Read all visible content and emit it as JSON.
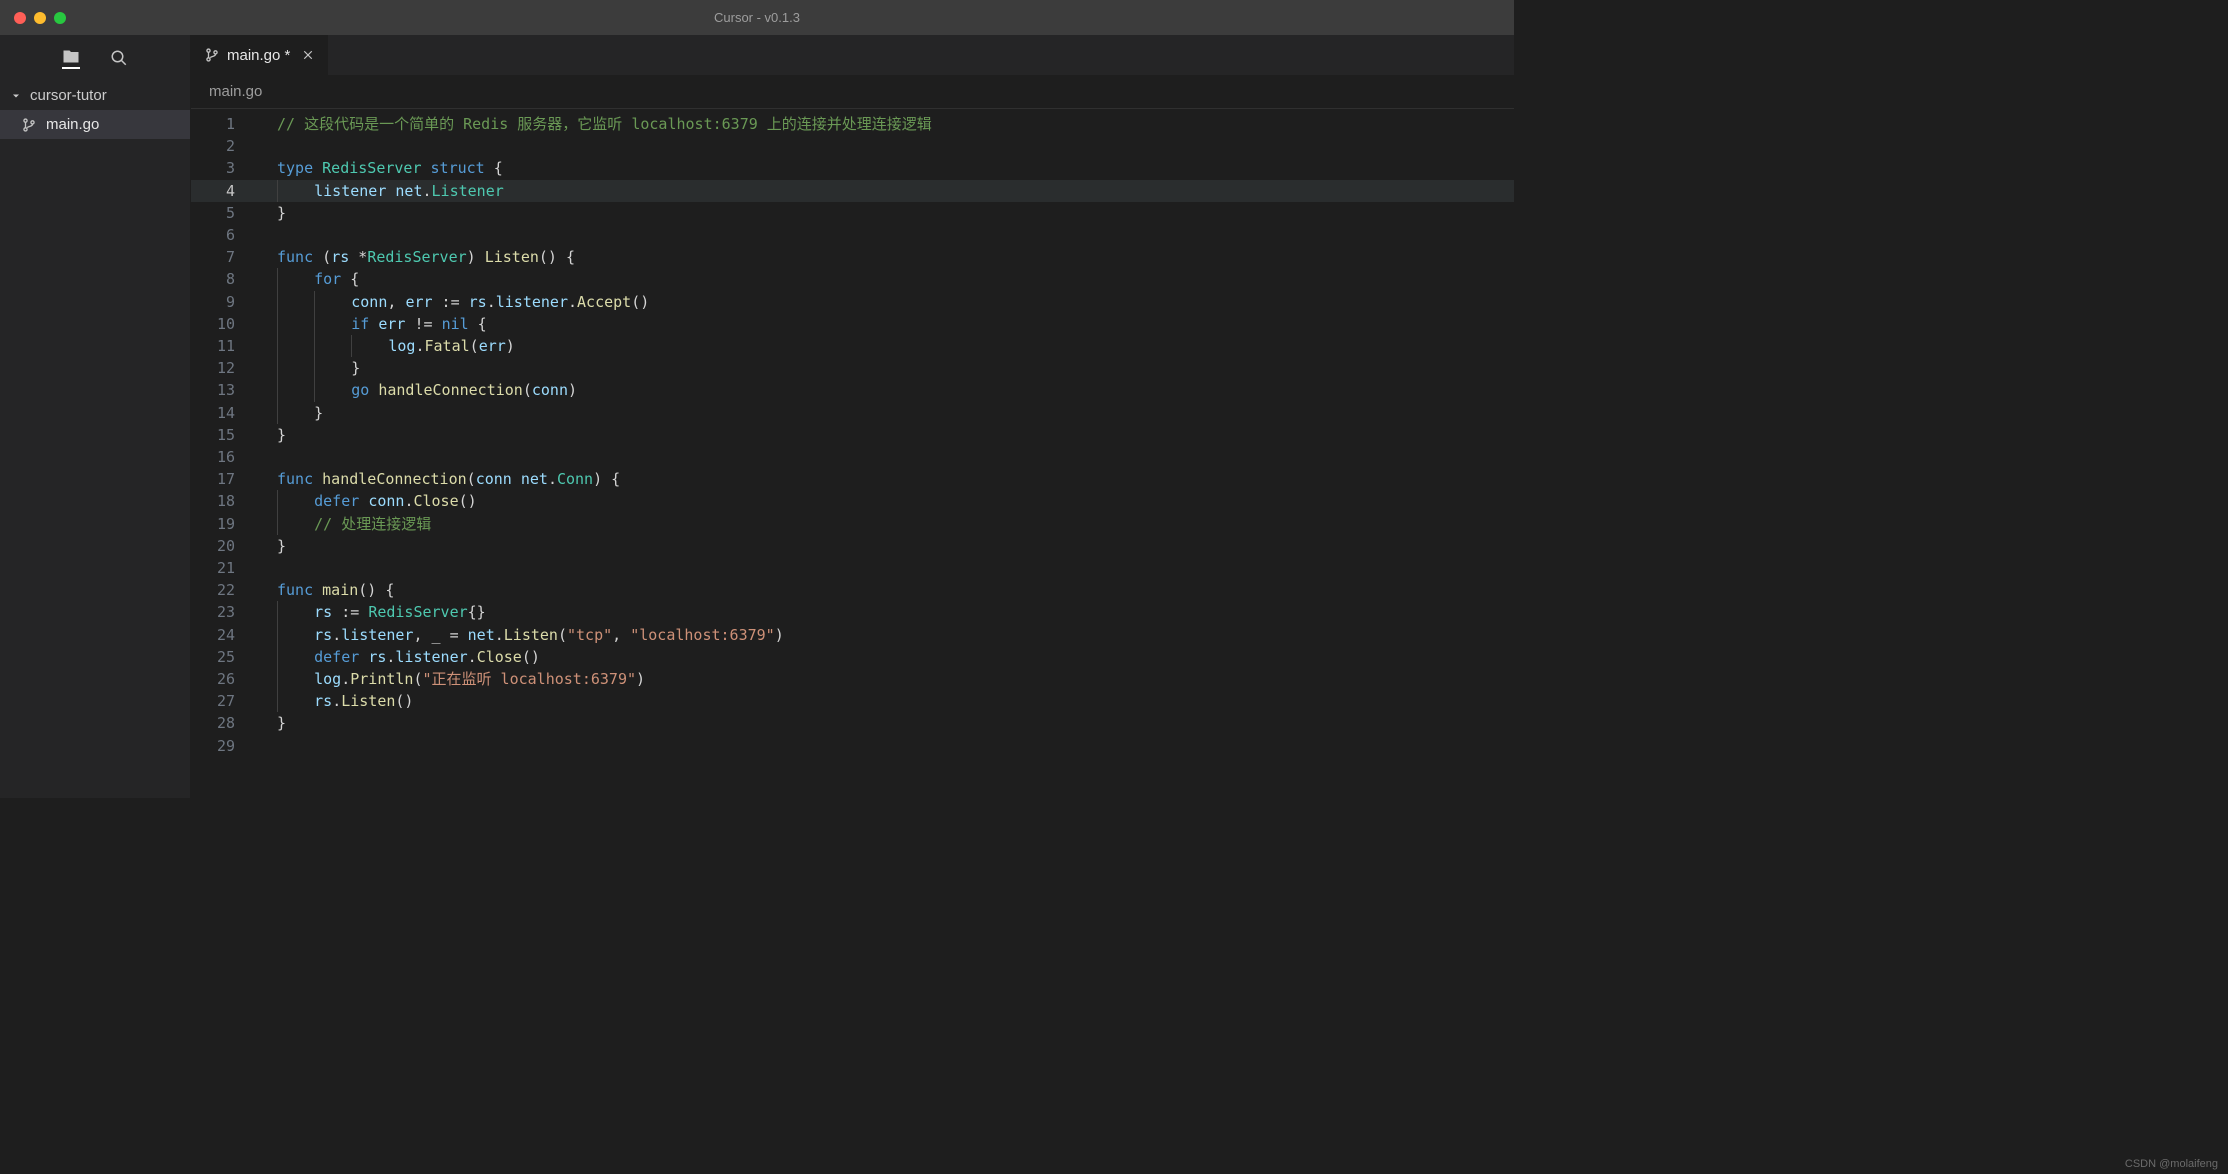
{
  "titlebar": {
    "title": "Cursor - v0.1.3"
  },
  "sidebar": {
    "project": "cursor-tutor",
    "files": [
      "main.go"
    ]
  },
  "tabs": [
    {
      "label": "main.go *"
    }
  ],
  "breadcrumb": "main.go",
  "active_line": 4,
  "code": {
    "lines": [
      {
        "n": 1,
        "seg": [
          {
            "t": "// 这段代码是一个简单的 Redis 服务器，它监听 localhost:6379 上的连接并处理连接逻辑",
            "c": "cmt"
          }
        ],
        "indent": 0
      },
      {
        "n": 2,
        "seg": [],
        "indent": 0
      },
      {
        "n": 3,
        "seg": [
          {
            "t": "type",
            "c": "kw"
          },
          {
            "t": " ",
            "c": "pl"
          },
          {
            "t": "RedisServer",
            "c": "type"
          },
          {
            "t": " ",
            "c": "pl"
          },
          {
            "t": "struct",
            "c": "kw"
          },
          {
            "t": " {",
            "c": "pl"
          }
        ],
        "indent": 0
      },
      {
        "n": 4,
        "seg": [
          {
            "t": "listener",
            "c": "id"
          },
          {
            "t": " ",
            "c": "pl"
          },
          {
            "t": "net",
            "c": "id"
          },
          {
            "t": ".",
            "c": "pl"
          },
          {
            "t": "Listener",
            "c": "type"
          }
        ],
        "indent": 1
      },
      {
        "n": 5,
        "seg": [
          {
            "t": "}",
            "c": "pl"
          }
        ],
        "indent": 0
      },
      {
        "n": 6,
        "seg": [],
        "indent": 0
      },
      {
        "n": 7,
        "seg": [
          {
            "t": "func",
            "c": "kw"
          },
          {
            "t": " (",
            "c": "pl"
          },
          {
            "t": "rs",
            "c": "id"
          },
          {
            "t": " *",
            "c": "pl"
          },
          {
            "t": "RedisServer",
            "c": "type"
          },
          {
            "t": ") ",
            "c": "pl"
          },
          {
            "t": "Listen",
            "c": "fn"
          },
          {
            "t": "() {",
            "c": "pl"
          }
        ],
        "indent": 0
      },
      {
        "n": 8,
        "seg": [
          {
            "t": "for",
            "c": "kw"
          },
          {
            "t": " {",
            "c": "pl"
          }
        ],
        "indent": 1
      },
      {
        "n": 9,
        "seg": [
          {
            "t": "conn",
            "c": "id"
          },
          {
            "t": ", ",
            "c": "pl"
          },
          {
            "t": "err",
            "c": "id"
          },
          {
            "t": " := ",
            "c": "pl"
          },
          {
            "t": "rs",
            "c": "id"
          },
          {
            "t": ".",
            "c": "pl"
          },
          {
            "t": "listener",
            "c": "id"
          },
          {
            "t": ".",
            "c": "pl"
          },
          {
            "t": "Accept",
            "c": "fn"
          },
          {
            "t": "()",
            "c": "pl"
          }
        ],
        "indent": 2
      },
      {
        "n": 10,
        "seg": [
          {
            "t": "if",
            "c": "kw"
          },
          {
            "t": " ",
            "c": "pl"
          },
          {
            "t": "err",
            "c": "id"
          },
          {
            "t": " != ",
            "c": "pl"
          },
          {
            "t": "nil",
            "c": "kw"
          },
          {
            "t": " {",
            "c": "pl"
          }
        ],
        "indent": 2
      },
      {
        "n": 11,
        "seg": [
          {
            "t": "log",
            "c": "id"
          },
          {
            "t": ".",
            "c": "pl"
          },
          {
            "t": "Fatal",
            "c": "fn"
          },
          {
            "t": "(",
            "c": "pl"
          },
          {
            "t": "err",
            "c": "id"
          },
          {
            "t": ")",
            "c": "pl"
          }
        ],
        "indent": 3
      },
      {
        "n": 12,
        "seg": [
          {
            "t": "}",
            "c": "pl"
          }
        ],
        "indent": 2
      },
      {
        "n": 13,
        "seg": [
          {
            "t": "go",
            "c": "kw"
          },
          {
            "t": " ",
            "c": "pl"
          },
          {
            "t": "handleConnection",
            "c": "fn"
          },
          {
            "t": "(",
            "c": "pl"
          },
          {
            "t": "conn",
            "c": "id"
          },
          {
            "t": ")",
            "c": "pl"
          }
        ],
        "indent": 2
      },
      {
        "n": 14,
        "seg": [
          {
            "t": "}",
            "c": "pl"
          }
        ],
        "indent": 1
      },
      {
        "n": 15,
        "seg": [
          {
            "t": "}",
            "c": "pl"
          }
        ],
        "indent": 0
      },
      {
        "n": 16,
        "seg": [],
        "indent": 0
      },
      {
        "n": 17,
        "seg": [
          {
            "t": "func",
            "c": "kw"
          },
          {
            "t": " ",
            "c": "pl"
          },
          {
            "t": "handleConnection",
            "c": "fn"
          },
          {
            "t": "(",
            "c": "pl"
          },
          {
            "t": "conn",
            "c": "id"
          },
          {
            "t": " ",
            "c": "pl"
          },
          {
            "t": "net",
            "c": "id"
          },
          {
            "t": ".",
            "c": "pl"
          },
          {
            "t": "Conn",
            "c": "type"
          },
          {
            "t": ") {",
            "c": "pl"
          }
        ],
        "indent": 0
      },
      {
        "n": 18,
        "seg": [
          {
            "t": "defer",
            "c": "kw"
          },
          {
            "t": " ",
            "c": "pl"
          },
          {
            "t": "conn",
            "c": "id"
          },
          {
            "t": ".",
            "c": "pl"
          },
          {
            "t": "Close",
            "c": "fn"
          },
          {
            "t": "()",
            "c": "pl"
          }
        ],
        "indent": 1
      },
      {
        "n": 19,
        "seg": [
          {
            "t": "// 处理连接逻辑",
            "c": "cmt"
          }
        ],
        "indent": 1
      },
      {
        "n": 20,
        "seg": [
          {
            "t": "}",
            "c": "pl"
          }
        ],
        "indent": 0
      },
      {
        "n": 21,
        "seg": [],
        "indent": 0
      },
      {
        "n": 22,
        "seg": [
          {
            "t": "func",
            "c": "kw"
          },
          {
            "t": " ",
            "c": "pl"
          },
          {
            "t": "main",
            "c": "fn"
          },
          {
            "t": "() {",
            "c": "pl"
          }
        ],
        "indent": 0
      },
      {
        "n": 23,
        "seg": [
          {
            "t": "rs",
            "c": "id"
          },
          {
            "t": " := ",
            "c": "pl"
          },
          {
            "t": "RedisServer",
            "c": "type"
          },
          {
            "t": "{}",
            "c": "pl"
          }
        ],
        "indent": 1
      },
      {
        "n": 24,
        "seg": [
          {
            "t": "rs",
            "c": "id"
          },
          {
            "t": ".",
            "c": "pl"
          },
          {
            "t": "listener",
            "c": "id"
          },
          {
            "t": ", _ = ",
            "c": "pl"
          },
          {
            "t": "net",
            "c": "id"
          },
          {
            "t": ".",
            "c": "pl"
          },
          {
            "t": "Listen",
            "c": "fn"
          },
          {
            "t": "(",
            "c": "pl"
          },
          {
            "t": "\"tcp\"",
            "c": "str"
          },
          {
            "t": ", ",
            "c": "pl"
          },
          {
            "t": "\"localhost:6379\"",
            "c": "str"
          },
          {
            "t": ")",
            "c": "pl"
          }
        ],
        "indent": 1
      },
      {
        "n": 25,
        "seg": [
          {
            "t": "defer",
            "c": "kw"
          },
          {
            "t": " ",
            "c": "pl"
          },
          {
            "t": "rs",
            "c": "id"
          },
          {
            "t": ".",
            "c": "pl"
          },
          {
            "t": "listener",
            "c": "id"
          },
          {
            "t": ".",
            "c": "pl"
          },
          {
            "t": "Close",
            "c": "fn"
          },
          {
            "t": "()",
            "c": "pl"
          }
        ],
        "indent": 1
      },
      {
        "n": 26,
        "seg": [
          {
            "t": "log",
            "c": "id"
          },
          {
            "t": ".",
            "c": "pl"
          },
          {
            "t": "Println",
            "c": "fn"
          },
          {
            "t": "(",
            "c": "pl"
          },
          {
            "t": "\"正在监听 localhost:6379\"",
            "c": "str"
          },
          {
            "t": ")",
            "c": "pl"
          }
        ],
        "indent": 1
      },
      {
        "n": 27,
        "seg": [
          {
            "t": "rs",
            "c": "id"
          },
          {
            "t": ".",
            "c": "pl"
          },
          {
            "t": "Listen",
            "c": "fn"
          },
          {
            "t": "()",
            "c": "pl"
          }
        ],
        "indent": 1
      },
      {
        "n": 28,
        "seg": [
          {
            "t": "}",
            "c": "pl"
          }
        ],
        "indent": 0
      },
      {
        "n": 29,
        "seg": [],
        "indent": 0
      }
    ]
  },
  "watermark": "CSDN @molaifeng"
}
